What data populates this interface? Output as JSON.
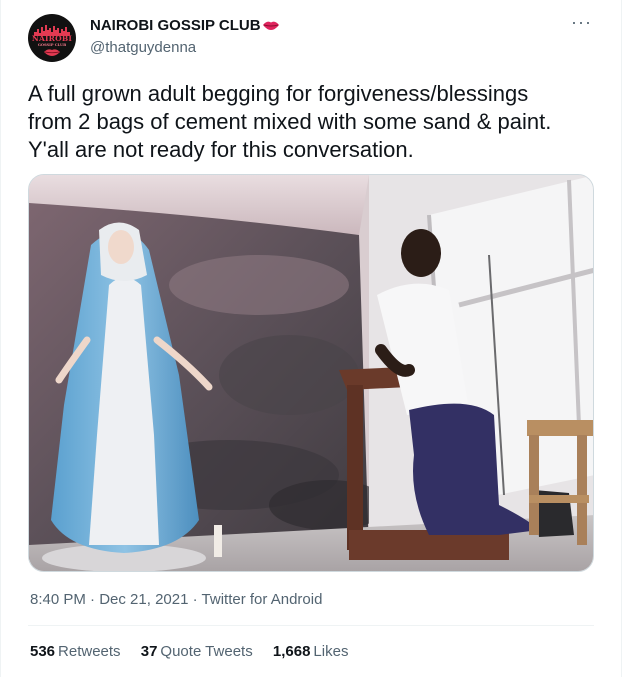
{
  "account": {
    "display_name": "NAIROBI GOSSIP CLUB",
    "handle": "@thatguydenna",
    "avatar_text_main": "NAIROBI",
    "avatar_text_sub": "GOSSIP CLUB",
    "name_emoji": "lips-icon"
  },
  "more_menu": {
    "label": "···"
  },
  "tweet": {
    "lines": [
      "A full grown adult begging for forgiveness/blessings",
      "from 2 bags of cement mixed with some sand & paint.",
      "Y'all are not ready for this conversation."
    ]
  },
  "meta": {
    "time": "8:40 PM",
    "separator": "·",
    "date": "Dec 21, 2021",
    "source": "Twitter for Android"
  },
  "stats": {
    "retweets_count": "536",
    "retweets_label": "Retweets",
    "quotes_count": "37",
    "quotes_label": "Quote Tweets",
    "likes_count": "1,668",
    "likes_label": "Likes"
  },
  "colors": {
    "text_primary": "#0f1419",
    "text_secondary": "#536471",
    "divider": "#eff3f4",
    "brand_pink": "#e23a52"
  }
}
